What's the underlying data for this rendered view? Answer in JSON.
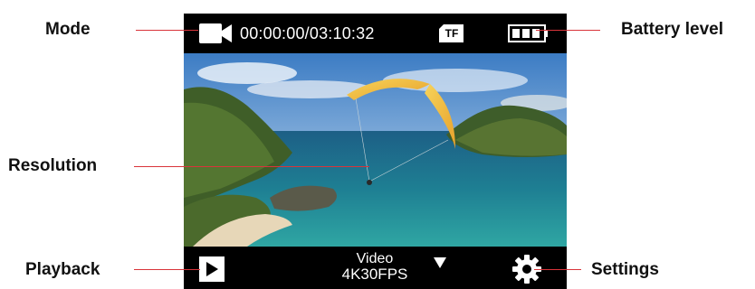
{
  "callouts": {
    "mode": "Mode",
    "resolution": "Resolution",
    "playback": "Playback",
    "battery": "Battery level",
    "settings": "Settings"
  },
  "status_bar": {
    "timecode": "00:00:00/03:10:32",
    "storage": "TF",
    "mode_icon": "video-camera-icon",
    "storage_icon": "sd-card-icon",
    "battery_icon": "battery-icon",
    "battery_level": 1.0
  },
  "bottom_bar": {
    "mode": "Video",
    "resolution": "4K30FPS",
    "playback_icon": "play-icon",
    "dropdown_icon": "triangle-down-icon",
    "settings_icon": "gear-icon"
  },
  "colors": {
    "leader": "#d9343a",
    "screen_bg": "#000000",
    "icon": "#ffffff"
  }
}
